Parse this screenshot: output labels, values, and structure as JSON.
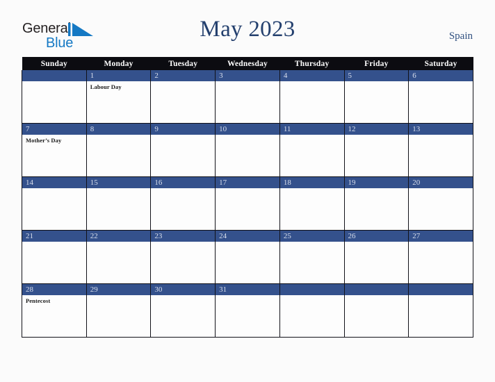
{
  "brand": {
    "name_part1": "General",
    "name_part2": "Blue",
    "triangle_icon": "blue-triangle-icon",
    "accent_color": "#1579c4"
  },
  "header": {
    "title": "May 2023",
    "country": "Spain",
    "title_color": "#24406e"
  },
  "calendar": {
    "weekday_headers": [
      "Sunday",
      "Monday",
      "Tuesday",
      "Wednesday",
      "Thursday",
      "Friday",
      "Saturday"
    ],
    "header_bg": "#0c0c11",
    "daynum_bg": "#34518c",
    "daynum_color": "#d9dfec",
    "weeks": [
      [
        {
          "day": "",
          "events": []
        },
        {
          "day": "1",
          "events": [
            "Labour Day"
          ]
        },
        {
          "day": "2",
          "events": []
        },
        {
          "day": "3",
          "events": []
        },
        {
          "day": "4",
          "events": []
        },
        {
          "day": "5",
          "events": []
        },
        {
          "day": "6",
          "events": []
        }
      ],
      [
        {
          "day": "7",
          "events": [
            "Mother’s Day"
          ]
        },
        {
          "day": "8",
          "events": []
        },
        {
          "day": "9",
          "events": []
        },
        {
          "day": "10",
          "events": []
        },
        {
          "day": "11",
          "events": []
        },
        {
          "day": "12",
          "events": []
        },
        {
          "day": "13",
          "events": []
        }
      ],
      [
        {
          "day": "14",
          "events": []
        },
        {
          "day": "15",
          "events": []
        },
        {
          "day": "16",
          "events": []
        },
        {
          "day": "17",
          "events": []
        },
        {
          "day": "18",
          "events": []
        },
        {
          "day": "19",
          "events": []
        },
        {
          "day": "20",
          "events": []
        }
      ],
      [
        {
          "day": "21",
          "events": []
        },
        {
          "day": "22",
          "events": []
        },
        {
          "day": "23",
          "events": []
        },
        {
          "day": "24",
          "events": []
        },
        {
          "day": "25",
          "events": []
        },
        {
          "day": "26",
          "events": []
        },
        {
          "day": "27",
          "events": []
        }
      ],
      [
        {
          "day": "28",
          "events": [
            "Pentecost"
          ]
        },
        {
          "day": "29",
          "events": []
        },
        {
          "day": "30",
          "events": []
        },
        {
          "day": "31",
          "events": []
        },
        {
          "day": "",
          "events": []
        },
        {
          "day": "",
          "events": []
        },
        {
          "day": "",
          "events": []
        }
      ]
    ]
  }
}
